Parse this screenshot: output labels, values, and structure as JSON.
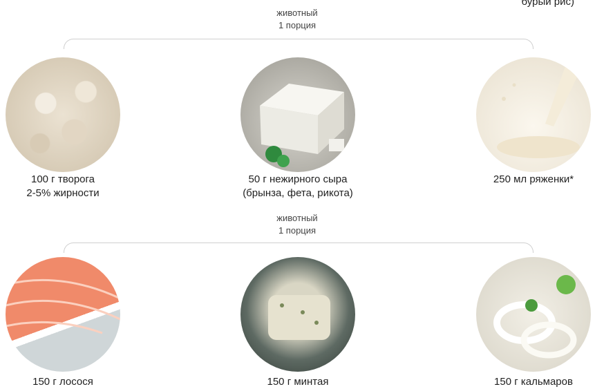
{
  "top_cut_text": "бурый рис)",
  "groups": [
    {
      "type_label": "животный",
      "portion_label": "1 порция",
      "items": [
        {
          "line1": "100 г творога",
          "line2": "2-5% жирности"
        },
        {
          "line1": "50 г нежирного сыра",
          "line2": "(брынза, фета, рикота)"
        },
        {
          "line1": "250 мл ряженки*",
          "line2": ""
        }
      ]
    },
    {
      "type_label": "животный",
      "portion_label": "1 порция",
      "items": [
        {
          "line1": "150 г лосося",
          "line2": ""
        },
        {
          "line1": "150 г минтая",
          "line2": ""
        },
        {
          "line1": "150 г кальмаров",
          "line2": ""
        }
      ]
    }
  ]
}
